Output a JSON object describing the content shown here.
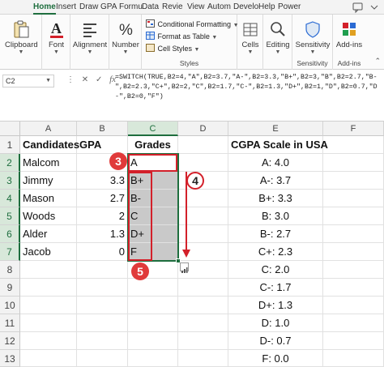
{
  "tabs": [
    "Home",
    "Insert",
    "Draw",
    "GPA",
    "Formu",
    "Data",
    "Revie",
    "View",
    "Autom",
    "Develo",
    "Help",
    "Power"
  ],
  "active_tab": "Home",
  "ribbon": {
    "clipboard": "Clipboard",
    "font": "Font",
    "alignment": "Alignment",
    "number": "Number",
    "conditional_formatting": "Conditional Formatting",
    "format_as_table": "Format as Table",
    "cell_styles": "Cell Styles",
    "styles_group": "Styles",
    "cells": "Cells",
    "editing": "Editing",
    "sensitivity": "Sensitivity",
    "sensitivity_group": "Sensitivity",
    "addins": "Add-ins",
    "addins_group": "Add-ins"
  },
  "formula_bar": {
    "name_box": "C2",
    "fx": "fx",
    "formula": "=SWITCH(TRUE,B2=4,\"A\",B2=3.7,\"A-\",B2=3.3,\"B+\",B2=3,\"B\",B2=2.7,\"B-\",B2=2.3,\"C+\",B2=2,\"C\",B2=1.7,\"C-\",B2=1.3,\"D+\",B2=1,\"D\",B2=0.7,\"D-\",B2=0,\"F\")"
  },
  "columns": [
    "A",
    "B",
    "C",
    "D",
    "E",
    "F"
  ],
  "rows": [
    "1",
    "2",
    "3",
    "4",
    "5",
    "6",
    "7",
    "8",
    "9",
    "10",
    "11",
    "12",
    "13"
  ],
  "headers": {
    "candidates": "Candidates",
    "gpa": "GPA",
    "grades": "Grades",
    "scale_title": "CGPA Scale in USA"
  },
  "students": [
    {
      "name": "Malcom",
      "gpa": "",
      "grade": "A"
    },
    {
      "name": "Jimmy",
      "gpa": "3.3",
      "grade": "B+"
    },
    {
      "name": "Mason",
      "gpa": "2.7",
      "grade": "B-"
    },
    {
      "name": "Woods",
      "gpa": "2",
      "grade": "C"
    },
    {
      "name": "Alder",
      "gpa": "1.3",
      "grade": "D+"
    },
    {
      "name": "Jacob",
      "gpa": "0",
      "grade": "F"
    }
  ],
  "scale": [
    "A: 4.0",
    "A-: 3.7",
    "B+: 3.3",
    "B: 3.0",
    "B-: 2.7",
    "C+: 2.3",
    "C: 2.0",
    "C-: 1.7",
    "D+: 1.3",
    "D: 1.0",
    "D-: 0.7",
    "F: 0.0"
  ],
  "callouts": {
    "three": "3",
    "four": "4",
    "five": "5"
  },
  "colors": {
    "excel_green": "#1e6e3e",
    "callout_red": "#d3202a",
    "selection_gray": "#c9c9c9"
  }
}
